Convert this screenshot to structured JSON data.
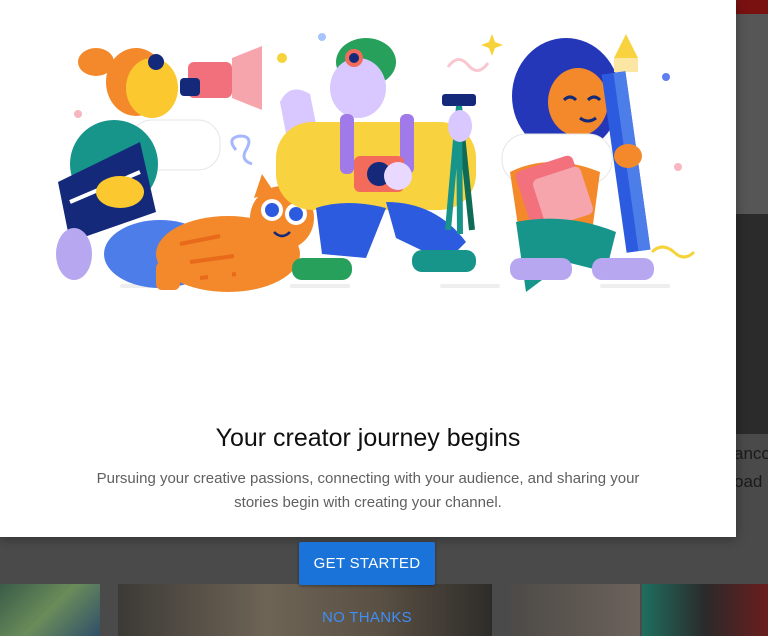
{
  "dialog": {
    "title": "Your creator journey begins",
    "description": "Pursuing your creative passions, connecting with your audience, and sharing your stories begin with creating your channel.",
    "illustration_icon": "creators-illustration-icon"
  },
  "actions": {
    "get_started_label": "GET STARTED",
    "no_thanks_label": "NO THANKS"
  },
  "background": {
    "partial_text_line1": "anco",
    "partial_text_line2": "oad"
  },
  "colors": {
    "primary_button": "#1a73d8",
    "text_button": "#3e8ef7",
    "title": "#0f0f0f",
    "description": "#606060"
  }
}
